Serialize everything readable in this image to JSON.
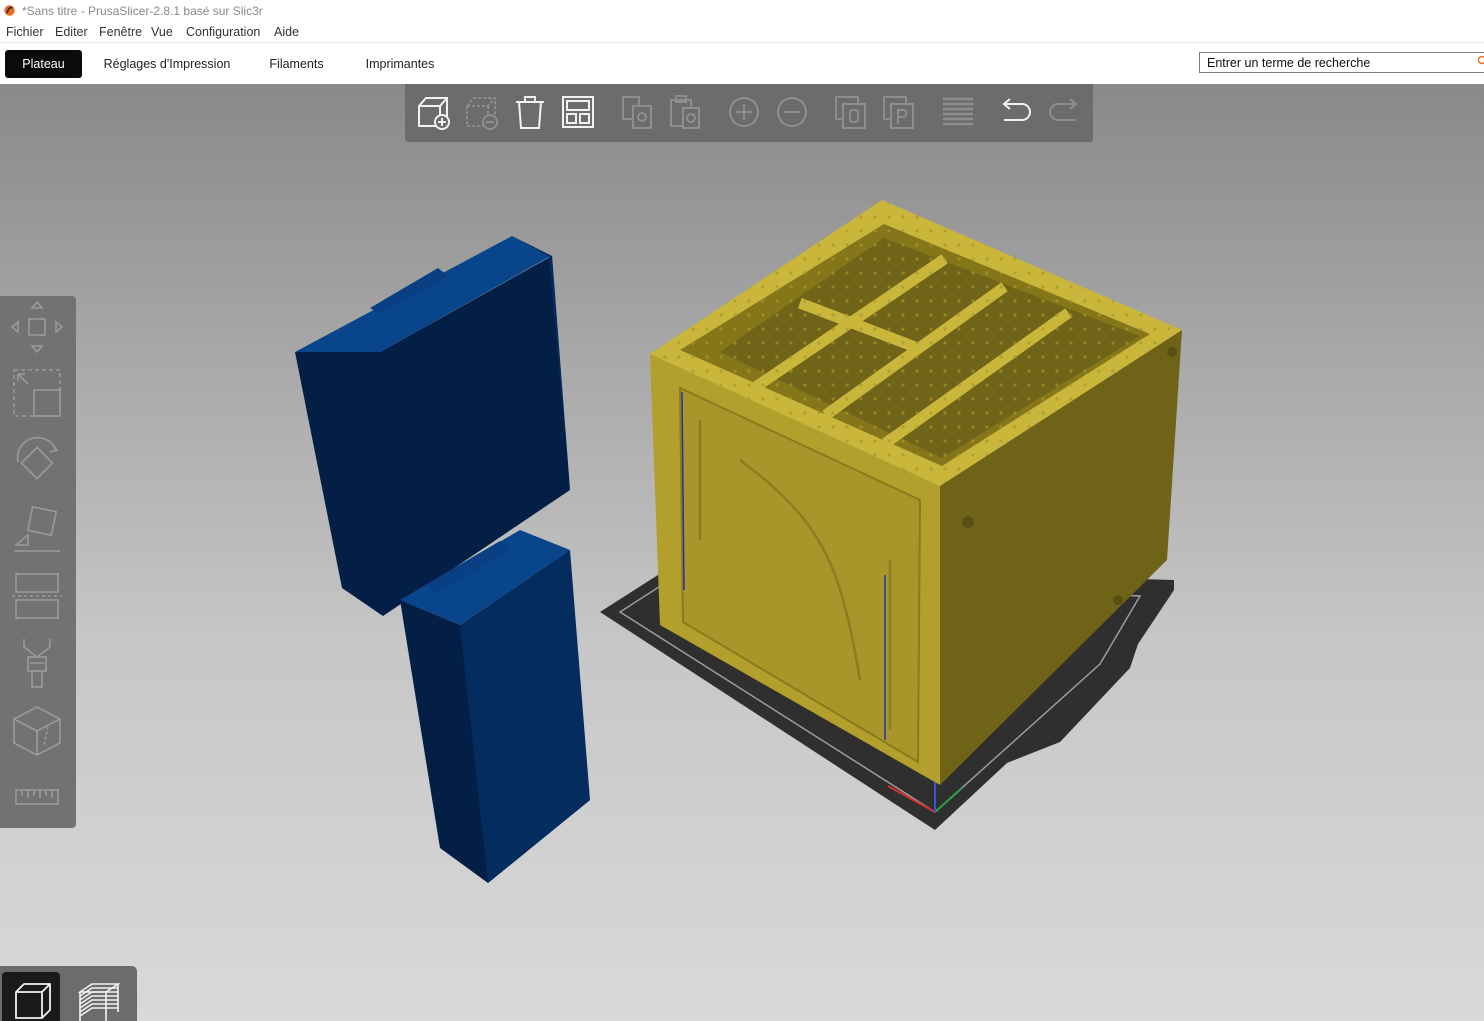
{
  "window": {
    "title": "*Sans titre - PrusaSlicer-2.8.1 basé sur Slic3r"
  },
  "menu": {
    "items": [
      "Fichier",
      "Editer",
      "Fenêtre",
      "Vue",
      "Configuration",
      "Aide"
    ]
  },
  "tabs": [
    {
      "label": "Plateau",
      "active": true
    },
    {
      "label": "Réglages d'Impression",
      "active": false
    },
    {
      "label": "Filaments",
      "active": false
    },
    {
      "label": "Imprimantes",
      "active": false
    }
  ],
  "search": {
    "placeholder": "Entrer un terme de recherche",
    "icon": "search-icon"
  },
  "colors": {
    "accent": "#ed6b21",
    "model_yellow": "#c9b63b",
    "model_blue": "#063a7a",
    "bed": "#2e2e2e",
    "toolbar": "#6c6c6c"
  },
  "top_toolbar": {
    "tools": [
      {
        "icon": "add-object-icon",
        "enabled": true
      },
      {
        "icon": "delete-object-icon",
        "enabled": false
      },
      {
        "icon": "delete-all-icon",
        "enabled": true
      },
      {
        "icon": "arrange-icon",
        "enabled": true
      },
      {
        "icon": "copy-icon",
        "enabled": false
      },
      {
        "icon": "paste-icon",
        "enabled": false
      },
      {
        "icon": "add-instance-icon",
        "enabled": false
      },
      {
        "icon": "remove-instance-icon",
        "enabled": false
      },
      {
        "icon": "split-objects-icon",
        "enabled": false
      },
      {
        "icon": "split-parts-icon",
        "enabled": false
      },
      {
        "icon": "layers-editing-icon",
        "enabled": false
      },
      {
        "icon": "undo-icon",
        "enabled": true
      },
      {
        "icon": "redo-icon",
        "enabled": false
      }
    ]
  },
  "left_toolbar": {
    "tools": [
      "move-icon",
      "scale-icon",
      "rotate-icon",
      "place-on-face-icon",
      "cut-icon",
      "paint-supports-icon",
      "seam-painting-icon",
      "measure-icon"
    ]
  },
  "view_switch": {
    "buttons": [
      {
        "icon": "3d-view-icon",
        "active": true
      },
      {
        "icon": "preview-layers-icon",
        "active": false
      }
    ]
  }
}
